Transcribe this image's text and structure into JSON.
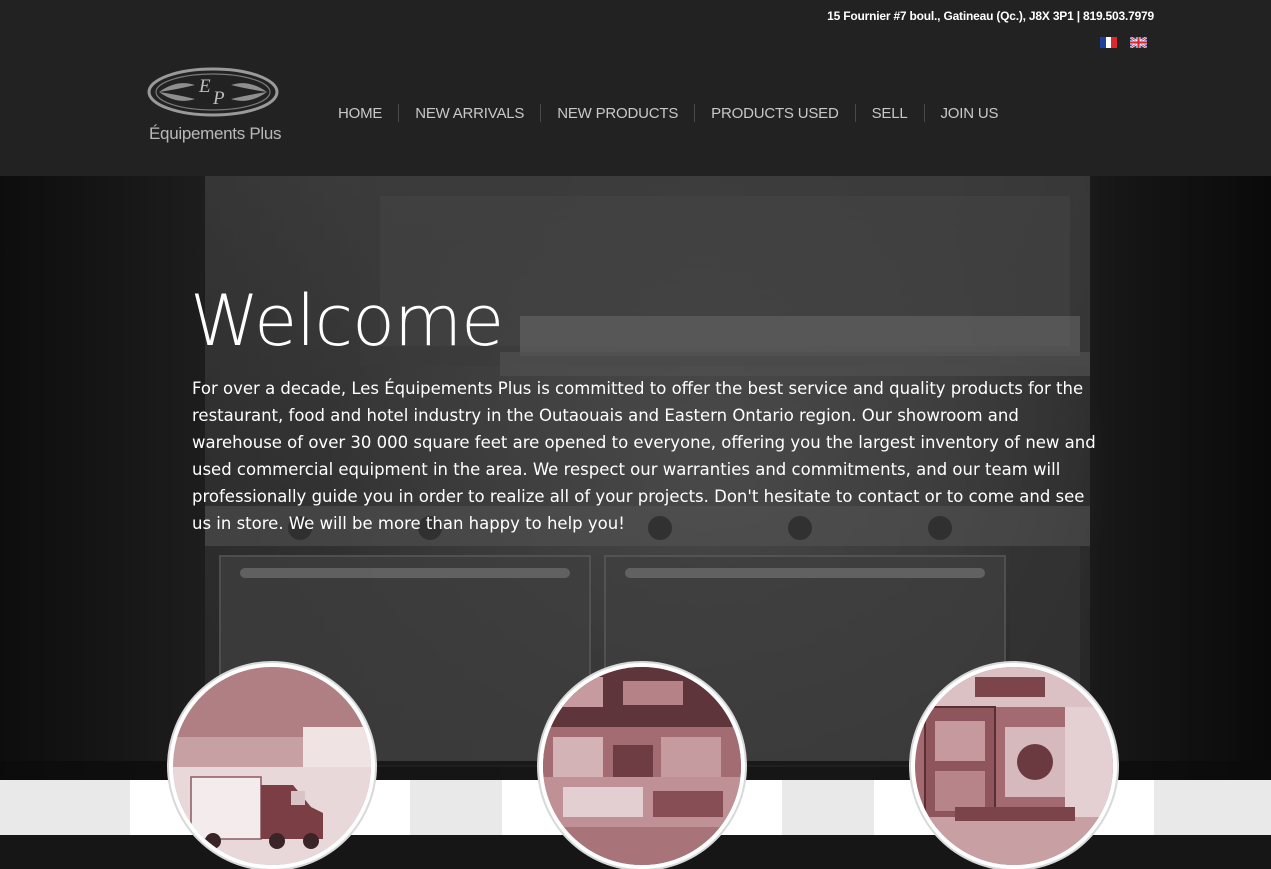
{
  "header": {
    "contact": "15 Fournier #7 boul., Gatineau (Qc.), J8X 3P1 | 819.503.7979",
    "languages": [
      {
        "code": "fr",
        "icon": "france-flag-icon"
      },
      {
        "code": "en",
        "icon": "uk-flag-icon"
      }
    ],
    "logo": {
      "monogram": "EP",
      "name": "Équipements Plus"
    }
  },
  "nav": {
    "items": [
      "HOME",
      "NEW ARRIVALS",
      "NEW PRODUCTS",
      "PRODUCTS USED",
      "SELL",
      "JOIN US"
    ]
  },
  "hero": {
    "title": "Welcome",
    "text": "For over a decade, Les Équipements Plus is committed to offer the best service and quality products for the restaurant, food and hotel industry in the Outaouais and Eastern Ontario region. Our showroom and warehouse of over 30 000 square feet are opened to everyone, offering you the largest inventory of new and used commercial equipment in the area. We respect our warranties and commitments, and our team will professionally guide you in order to realize all of your projects. Don't hesitate to contact or to come and see us in store. We will be more than happy to help you!"
  },
  "features": [
    {
      "icon": "truck-image"
    },
    {
      "icon": "showroom-image"
    },
    {
      "icon": "kitchen-image"
    }
  ],
  "colors": {
    "header_bg": "#222222",
    "nav_text": "#c8c8c8",
    "photo_tint": "#a8686f",
    "strip_bg": "#e9e9e9"
  }
}
